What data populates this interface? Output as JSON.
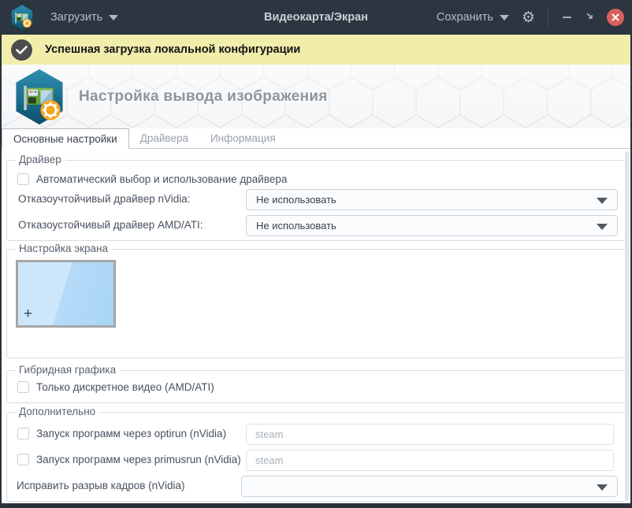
{
  "titlebar": {
    "load_label": "Загрузить",
    "title": "Видеокарта/Экран",
    "save_label": "Сохранить",
    "gear_glyph": "⚙"
  },
  "notification": {
    "text": "Успешная загрузка локальной конфигурации"
  },
  "header": {
    "title": "Настройка вывода изображения"
  },
  "tabs": [
    {
      "label": "Основные настройки",
      "active": true
    },
    {
      "label": "Драйвера",
      "active": false
    },
    {
      "label": "Информация",
      "active": false
    }
  ],
  "groups": {
    "driver": {
      "legend": "Драйвер",
      "auto_checkbox_label": "Автоматический выбор и использование драйвера",
      "nvidia_label": "Отказоучтойчивый драйвер nVidia:",
      "nvidia_value": "Не использовать",
      "amd_label": "Отказоустойчивый драйвер AMD/ATI:",
      "amd_value": "Не использовать"
    },
    "screen": {
      "legend": "Настройка экрана",
      "add_symbol": "+"
    },
    "hybrid": {
      "legend": "Гибридная графика",
      "discrete_checkbox_label": "Только дискретное видео (AMD/ATI)"
    },
    "extra": {
      "legend": "Дополнительно",
      "optirun_label": "Запуск программ через optirun (nVidia)",
      "optirun_placeholder": "steam",
      "primusrun_label": "Запуск программ через primusrun (nVidia)",
      "primusrun_placeholder": "steam",
      "tearing_label": "Исправить разрыв кадров (nVidia)",
      "tearing_value": ""
    }
  },
  "colors": {
    "titlebar_bg": "#2c3640",
    "notification_bg": "#f1eeac",
    "close_red": "#da5f5f",
    "icon_teal": "#14607f",
    "icon_orange": "#f6a41f",
    "screen_blue": "#a8d5f5"
  }
}
